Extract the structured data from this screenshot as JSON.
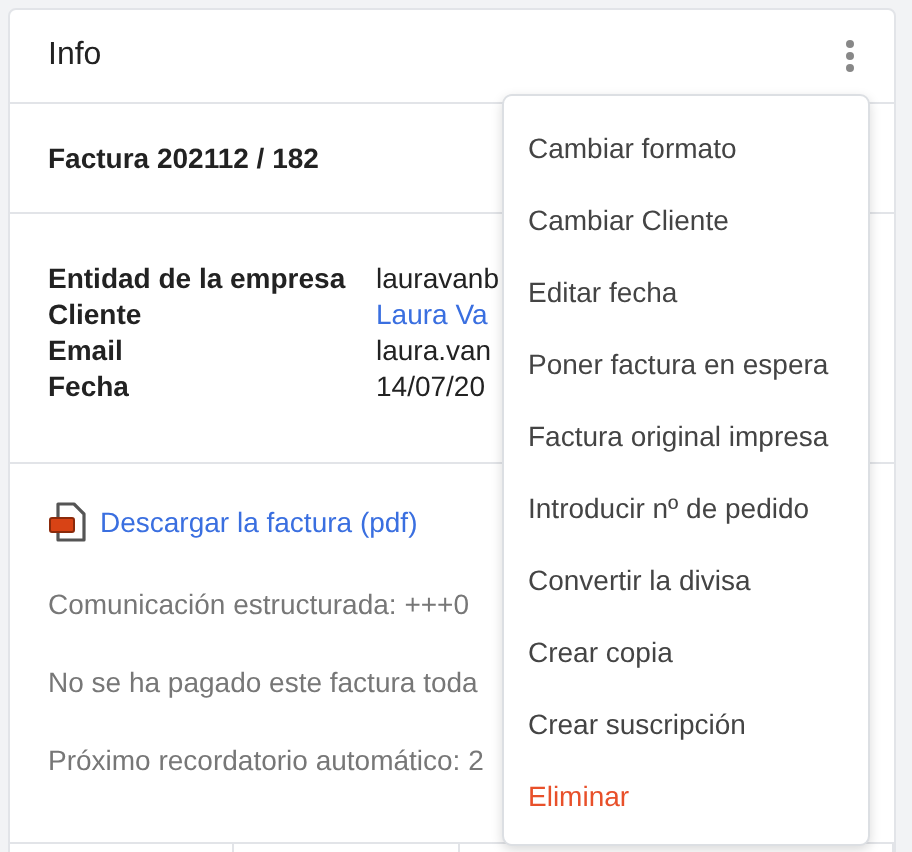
{
  "card": {
    "title": "Info",
    "invoice_title": "Factura 202112 / 182",
    "details": [
      {
        "label": "Entidad de la empresa",
        "value": "lauravanb",
        "kind": "text"
      },
      {
        "label": "Cliente",
        "value": "Laura Va",
        "kind": "link"
      },
      {
        "label": "Email",
        "value": "laura.van",
        "kind": "text"
      },
      {
        "label": "Fecha",
        "value": "14/07/20",
        "kind": "text"
      }
    ],
    "download_link": "Descargar la factura (pdf)",
    "notes": [
      "Comunicación estructurada: +++0",
      "No se ha pagado este factura toda",
      "Próximo recordatorio automático: 2"
    ]
  },
  "menu": {
    "items": [
      {
        "label": "Cambiar formato",
        "kind": "normal"
      },
      {
        "label": "Cambiar Cliente",
        "kind": "normal"
      },
      {
        "label": "Editar fecha",
        "kind": "normal"
      },
      {
        "label": "Poner factura en espera",
        "kind": "normal"
      },
      {
        "label": "Factura original impresa",
        "kind": "normal"
      },
      {
        "label": "Introducir nº de pedido",
        "kind": "normal"
      },
      {
        "label": "Convertir la divisa",
        "kind": "normal"
      },
      {
        "label": "Crear copia",
        "kind": "normal"
      },
      {
        "label": "Crear suscripción",
        "kind": "normal"
      },
      {
        "label": "Eliminar",
        "kind": "danger"
      }
    ]
  }
}
